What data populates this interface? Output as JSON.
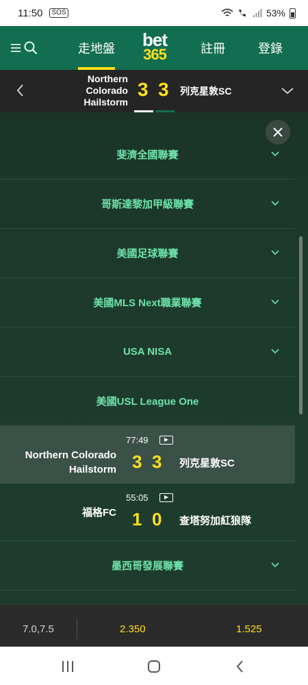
{
  "status_bar": {
    "time": "11:50",
    "notif_icon": "SOS",
    "battery": "53%"
  },
  "header": {
    "nav_inplay": "走地盤",
    "logo_top": "bet",
    "logo_bottom": "365",
    "nav_join": "註冊",
    "nav_login": "登錄"
  },
  "scoreboard": {
    "home": [
      "Northern",
      "Colorado",
      "Hailstorm"
    ],
    "home_score": "3",
    "away_score": "3",
    "away": "列克星敦SC"
  },
  "competitions_top": [
    {
      "label": "斐濟全國聯賽"
    },
    {
      "label": "哥斯達黎加甲級聯賽"
    },
    {
      "label": "美國足球聯賽"
    },
    {
      "label": "美國MLS Next職業聯賽"
    },
    {
      "label": "USA NISA"
    }
  ],
  "usl_header": {
    "label": "美國USL League One"
  },
  "matches": [
    {
      "time": "77:49",
      "home_line1": "Northern Colorado",
      "home_line2": "Hailstorm",
      "home_score": "3",
      "away_score": "3",
      "away": "列克星敦SC"
    },
    {
      "time": "55:05",
      "home_line1": "",
      "home_line2": "福格FC",
      "home_score": "1",
      "away_score": "0",
      "away": "查塔努加紅狼隊"
    }
  ],
  "competitions_bottom": [
    {
      "label": "墨西哥發展聯賽"
    }
  ],
  "odds_bar": {
    "line": "7.0,7.5",
    "odd_1": "2.350",
    "odd_2": "1.525"
  },
  "icons": [
    "menu-icon",
    "search-icon",
    "chevron-left-icon",
    "chevron-down-icon",
    "close-icon",
    "video-icon",
    "recents-icon",
    "home-icon",
    "back-icon"
  ],
  "colors": {
    "header_green": "#126e51",
    "accent_yellow": "#ffdf1b",
    "label_green": "#6fe3ac"
  }
}
